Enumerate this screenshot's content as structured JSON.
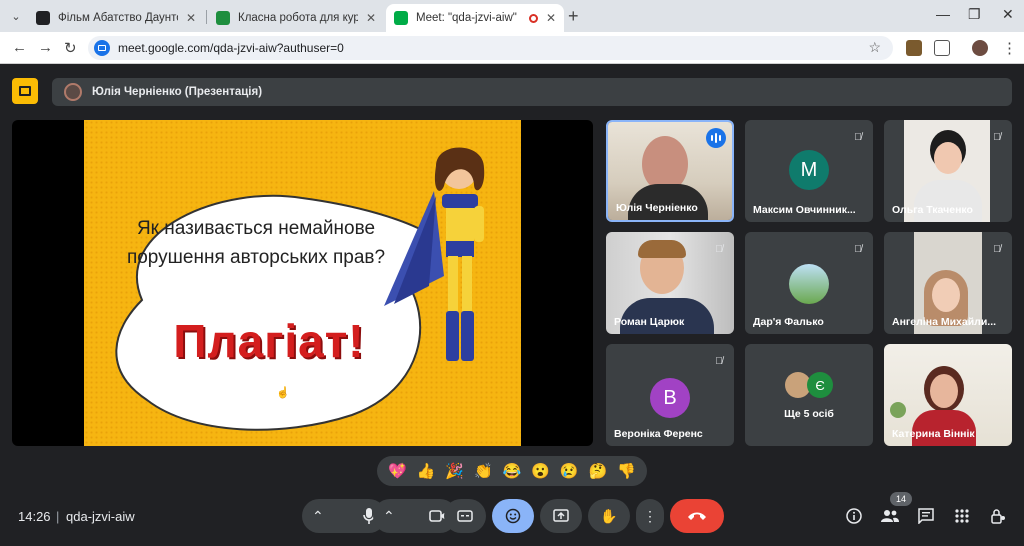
{
  "browser": {
    "tabs": [
      {
        "title": "Фільм Абатство Даунтон: Нов",
        "active": false
      },
      {
        "title": "Класна робота для курсу \"ЗАР",
        "active": false
      },
      {
        "title": "Meet: \"qda-jzvi-aiw\"",
        "active": true
      }
    ],
    "url": "meet.google.com/qda-jzvi-aiw?authuser=0"
  },
  "meet": {
    "presenter_label": "Юлія Черніенко (Презентація)",
    "slide": {
      "question": "Як називається немайнове порушення авторських прав?",
      "answer": "Плагіат!"
    },
    "participants": [
      {
        "name": "Юлія Черніенко",
        "speaking": true
      },
      {
        "name": "Максим Овчинник...",
        "initial": "М",
        "avatar_color": "#0f7b6c"
      },
      {
        "name": "Ольга Ткаченко"
      },
      {
        "name": "Роман Царюк"
      },
      {
        "name": "Дар'я Фалько"
      },
      {
        "name": "Ангеліна Михайли..."
      },
      {
        "name": "Вероніка Ференс",
        "initial": "В",
        "avatar_color": "#a142c4"
      },
      {
        "name": "Ще 5 осіб",
        "initial": "Є",
        "avatar_color": "#1e8e3e"
      },
      {
        "name": "Катерина Віннік"
      }
    ],
    "reactions": [
      "💖",
      "👍",
      "🎉",
      "👏",
      "😂",
      "😮",
      "😢",
      "🤔",
      "👎"
    ],
    "time": "14:26",
    "meeting_code": "qda-jzvi-aiw",
    "people_count": "14"
  }
}
